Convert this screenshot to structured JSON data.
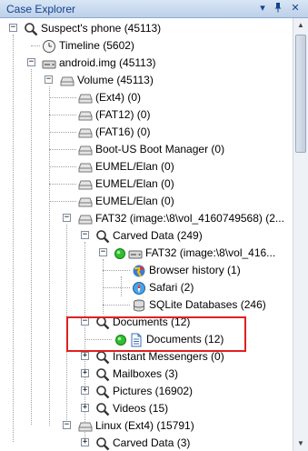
{
  "panel": {
    "title": "Case Explorer",
    "buttons": {
      "dropdown": "▾",
      "pin": "📌",
      "close": "✕"
    }
  },
  "tree": [
    {
      "label": "Suspect's phone (45113)",
      "icon": "search-icon",
      "expander": "−"
    },
    {
      "label": "Timeline (5602)",
      "icon": "clock-icon",
      "expander": ""
    },
    {
      "label": "android.img (45113)",
      "icon": "disk-image-icon",
      "expander": "−"
    },
    {
      "label": "Volume (45113)",
      "icon": "drive-icon",
      "expander": "−"
    },
    {
      "label": "(Ext4) (0)",
      "icon": "drive-icon",
      "expander": ""
    },
    {
      "label": "(FAT12) (0)",
      "icon": "drive-icon",
      "expander": ""
    },
    {
      "label": "(FAT16) (0)",
      "icon": "drive-icon",
      "expander": ""
    },
    {
      "label": "Boot-US Boot Manager (0)",
      "icon": "drive-icon",
      "expander": ""
    },
    {
      "label": "EUMEL/Elan (0)",
      "icon": "drive-icon",
      "expander": ""
    },
    {
      "label": "EUMEL/Elan (0)",
      "icon": "drive-icon",
      "expander": ""
    },
    {
      "label": "EUMEL/Elan (0)",
      "icon": "drive-icon",
      "expander": ""
    },
    {
      "label": "FAT32 (image:\\8\\vol_4160749568) (2...",
      "icon": "drive-icon",
      "expander": "−"
    },
    {
      "label": "Carved Data (249)",
      "icon": "search-icon",
      "expander": "−"
    },
    {
      "label": "FAT32 (image:\\8\\vol_416...",
      "icon": "disk-image-icon",
      "expander": "−",
      "status": "green"
    },
    {
      "label": "Browser history (1)",
      "icon": "browser-icon",
      "expander": ""
    },
    {
      "label": "Safari (2)",
      "icon": "safari-icon",
      "expander": ""
    },
    {
      "label": "SQLite Databases (246)",
      "icon": "database-icon",
      "expander": ""
    },
    {
      "label": "Documents (12)",
      "icon": "search-icon",
      "expander": "−"
    },
    {
      "label": "Documents (12)",
      "icon": "document-icon",
      "expander": "",
      "status": "green"
    },
    {
      "label": "Instant Messengers (0)",
      "icon": "search-icon",
      "expander": "+"
    },
    {
      "label": "Mailboxes (3)",
      "icon": "search-icon",
      "expander": "+"
    },
    {
      "label": "Pictures (16902)",
      "icon": "search-icon",
      "expander": "+"
    },
    {
      "label": "Videos (15)",
      "icon": "search-icon",
      "expander": "+"
    },
    {
      "label": "Linux (Ext4) (15791)",
      "icon": "drive-icon",
      "expander": "−"
    },
    {
      "label": "Carved Data (3)",
      "icon": "search-icon",
      "expander": "+"
    }
  ],
  "colors": {
    "highlight": "#e02020",
    "status_green": "#2fbf2f",
    "title_text": "#15428b"
  }
}
